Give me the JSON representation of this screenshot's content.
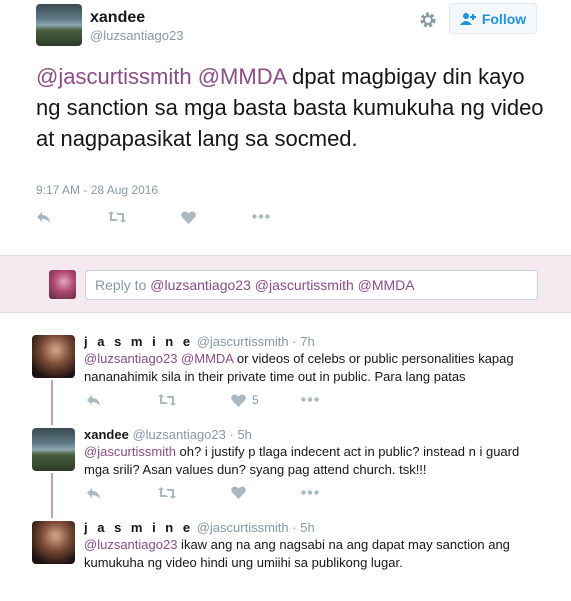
{
  "main_tweet": {
    "name": "xandee",
    "handle": "@luzsantiago23",
    "follow_label": "Follow",
    "mentions": [
      "@jascurtissmith",
      "@MMDA"
    ],
    "text_rest": " dpat magbigay din kayo ng sanction sa mga basta basta kumukuha ng video at nagpapasikat lang sa socmed.",
    "timestamp": "9:17 AM - 28 Aug 2016"
  },
  "reply_box": {
    "prefix": "Reply to ",
    "mentions": "@luzsantiago23 @jascurtissmith @MMDA"
  },
  "replies": [
    {
      "name": "j a s m i n e",
      "handle": "@jascurtissmith",
      "time": "· 7h",
      "mentions": "@luzsantiago23 @MMDA",
      "text": " or videos of celebs or public personalities kapag nananahimik sila in their private time out in public. Para lang patas",
      "likes": "5"
    },
    {
      "name": "xandee",
      "handle": "@luzsantiago23",
      "time": "· 5h",
      "mentions": "@jascurtissmith",
      "text": "  oh? i justify p tlaga indecent act in public? instead n i guard mga srili? Asan values dun? syang pag attend church. tsk!!!",
      "likes": ""
    },
    {
      "name": "j a s m i n e",
      "handle": "@jascurtissmith",
      "time": "· 5h",
      "mentions": "@luzsantiago23",
      "text": " ikaw ang na ang nagsabi na ang dapat may sanction ang kumukuha ng video hindi ung umiihi sa publikong lugar.",
      "likes": ""
    }
  ],
  "icons": [
    "gear-icon",
    "follow-person-icon",
    "reply-icon",
    "retweet-icon",
    "like-icon",
    "more-icon"
  ],
  "colors": {
    "mention": "#8d4b8a",
    "follow_text": "#1b95e0",
    "reply_bar_bg": "#f6eaf1",
    "thread_line": "#c99cc0",
    "muted": "#8899a6"
  }
}
